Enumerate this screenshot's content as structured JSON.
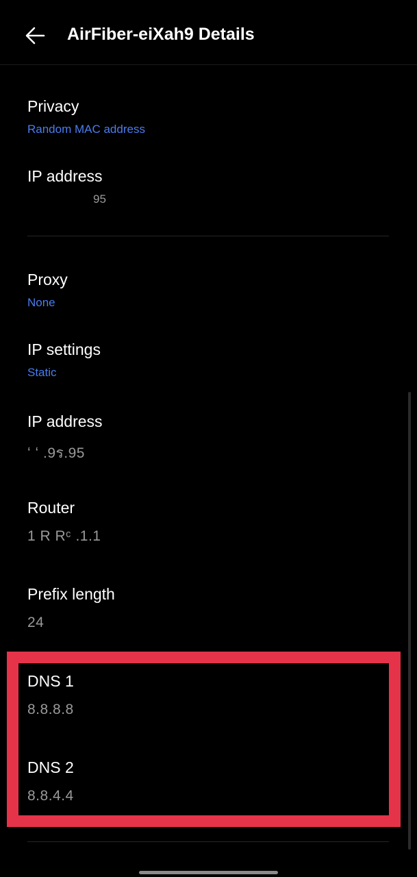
{
  "header": {
    "title": "AirFiber-eiXah9 Details"
  },
  "network_info": {
    "privacy": {
      "label": "Privacy",
      "value": "Random MAC address"
    },
    "ip_address": {
      "label": "IP address",
      "value": "95"
    }
  },
  "advanced": {
    "proxy": {
      "label": "Proxy",
      "value": "None"
    },
    "ip_settings": {
      "label": "IP settings",
      "value": "Static"
    },
    "ip_address": {
      "label": "IP address",
      "value": "ʻ ʻ .9ร.95"
    },
    "router": {
      "label": "Router",
      "value": "1 R  Rᶜ .1.1"
    },
    "prefix_length": {
      "label": "Prefix length",
      "value": "24"
    },
    "dns1": {
      "label": "DNS 1",
      "value": "8.8.8.8"
    },
    "dns2": {
      "label": "DNS 2",
      "value": "8.8.4.4"
    }
  },
  "colors": {
    "background": "#000000",
    "accent_blue": "#4a7df0",
    "highlight_red": "#e5334a",
    "secondary_text": "#9a9a9a"
  },
  "icons": {
    "back": "arrow-left-icon"
  }
}
